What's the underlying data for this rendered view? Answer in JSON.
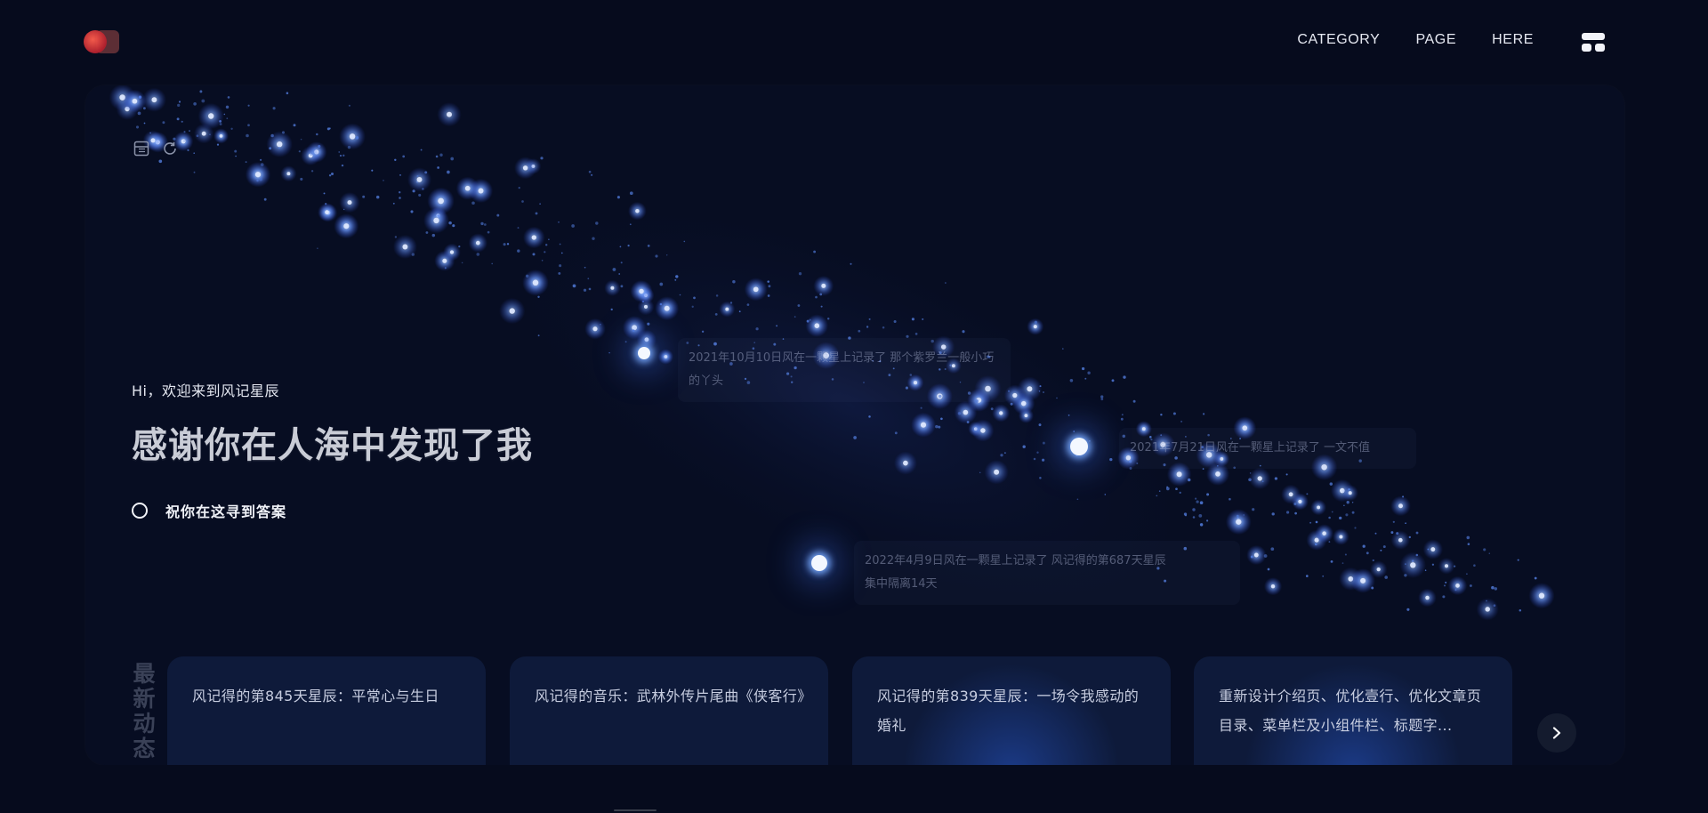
{
  "header": {
    "nav": [
      "CATEGORY",
      "PAGE",
      "HERE"
    ]
  },
  "hero": {
    "greeting": "Hi，欢迎来到风记星辰",
    "headline": "感谢你在人海中发现了我",
    "answer_label": "祝你在这寻到答案",
    "star_notes": [
      "2021年10月10日风在一颗星上记录了 那个紫罗兰一般小巧的丫头",
      "2021年7月21日风在一颗星上记录了 一文不值",
      "2022年4月9日风在一颗星上记录了 风记得的第687天星辰",
      "集中隔离14天"
    ]
  },
  "latest": {
    "title": [
      "最",
      "新",
      "动",
      "态"
    ],
    "cards": [
      "风记得的第845天星辰：平常心与生日",
      "风记得的音乐：武林外传片尾曲《侠客行》",
      "风记得的第839天星辰：一场令我感动的婚礼",
      "重新设计介绍页、优化壹行、优化文章页目录、菜单栏及小组件栏、标题字..."
    ]
  },
  "colors": {
    "background": "#060b1d",
    "card": "#0e1a3a",
    "star_glow": "#4a7dff"
  },
  "icons": [
    "layout-icon",
    "refresh-icon",
    "menu-icon",
    "chevron-right-icon"
  ]
}
